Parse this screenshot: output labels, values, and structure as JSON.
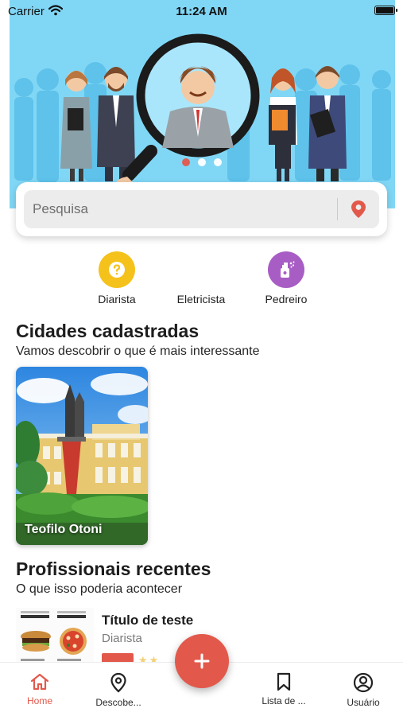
{
  "status_bar": {
    "carrier": "Carrier",
    "time": "11:24 AM"
  },
  "carousel": {
    "slide_count": 3,
    "active_slide": 1
  },
  "search": {
    "placeholder": "Pesquisa"
  },
  "categories": [
    {
      "label": "Diarista",
      "icon": "question-icon",
      "color": "#f4c21b"
    },
    {
      "label": "Eletricista",
      "icon": "none",
      "color": ""
    },
    {
      "label": "Pedreiro",
      "icon": "spray-bottle-icon",
      "color": "#a85dc4"
    }
  ],
  "cities_section": {
    "title": "Cidades cadastradas",
    "subtitle": "Vamos descobrir o que é mais interessante",
    "cities": [
      {
        "name": "Teofilo Otoni"
      }
    ]
  },
  "professionals_section": {
    "title": "Profissionais recentes",
    "subtitle": "O que isso poderia acontecer",
    "items": [
      {
        "title": "Título de teste",
        "category": "Diarista"
      }
    ]
  },
  "tabbar": {
    "tabs": [
      {
        "label": "Home",
        "icon": "home-icon",
        "active": true
      },
      {
        "label": "Descobe...",
        "icon": "location-pin-icon",
        "active": false
      },
      {
        "label": "Lista de ...",
        "icon": "bookmark-icon",
        "active": false
      },
      {
        "label": "Usuário",
        "icon": "user-circle-icon",
        "active": false
      }
    ]
  },
  "colors": {
    "accent": "#e2594c",
    "hero_background": "#7fd6f5"
  }
}
